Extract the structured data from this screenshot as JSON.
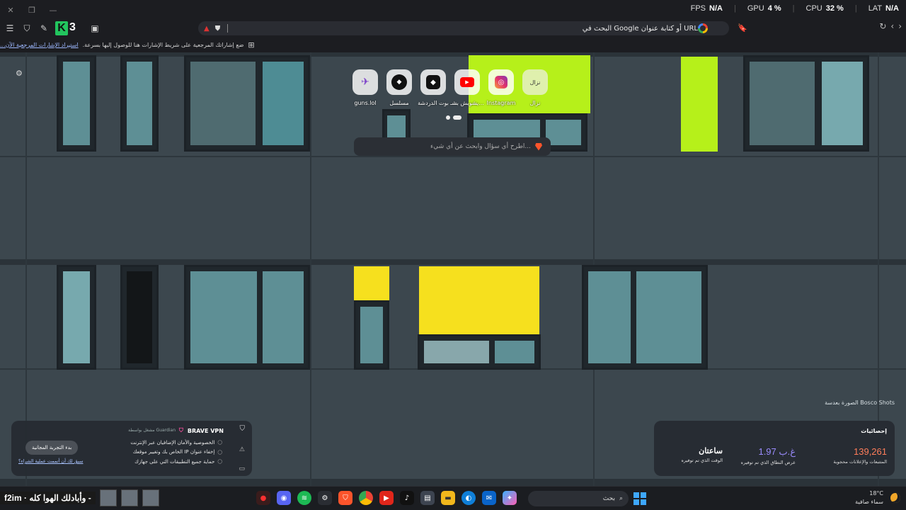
{
  "perf": {
    "fps_label": "FPS",
    "fps_value": "N/A",
    "gpu_label": "GPU",
    "gpu_value": "4 %",
    "cpu_label": "CPU",
    "cpu_value": "32 %",
    "lat_label": "LAT",
    "lat_value": "N/A"
  },
  "urlbar": {
    "placeholder": "البحث في Google أو كتابة عنوان URL"
  },
  "bookmarks_bar": {
    "message": "ضع إشاراتك المرجعية على شريط الإشارات هنا للوصول إليها بسرعة.",
    "import_link": "استيراد الإشارات المرجعية الآن..."
  },
  "top_sites": [
    {
      "label": "نزال",
      "icon": "nzal-icon",
      "glyph": "نزال"
    },
    {
      "label": "Instagram",
      "icon": "instagram-icon",
      "glyph": "◎"
    },
    {
      "label": "يشويش بشـ...",
      "icon": "youtube-icon",
      "glyph": "▶"
    },
    {
      "label": "بوت الدردشة",
      "icon": "chatbot-icon",
      "glyph": "◆"
    },
    {
      "label": "مسلسل",
      "icon": "series-icon",
      "glyph": "◆"
    },
    {
      "label": "guns.lol",
      "icon": "gun-icon",
      "glyph": "✈"
    }
  ],
  "search": {
    "placeholder": "اطرح أي سؤال وابحث عن أي شيء..."
  },
  "vpn": {
    "title": "BRAVE VPN",
    "powered_by": "مشغل بواسطة Guardian",
    "features": [
      "الخصوصية والأمان الإضافيان عبر الإنترنت",
      "إخفاء عنوان IP الخاص بك وتغيير موقعك",
      "حماية جميع التطبيقات التي على جهازك"
    ],
    "trial_button": "بدء التجربة المجانية",
    "already_link": "سبق لك أن أتممت عملية الشراء؟"
  },
  "stats": {
    "title": "إحصائيات",
    "items": [
      {
        "value": "139,261",
        "caption": "المتتبعات والإعلانات محجوبة",
        "color": "#ff7d5a"
      },
      {
        "value": "1.97 غ.ب",
        "caption": "عرض النطاق الذي تم توفيره",
        "color": "#9b8cff"
      },
      {
        "value": "ساعتان",
        "caption": "الوقت الذي تم توفيره",
        "color": "#ffffff"
      }
    ]
  },
  "photo_credit": "الصورة بعدسة Bosco Shots",
  "taskbar": {
    "media_text": "f2im",
    "ticker_text": "وأبادلك الهوا كله -",
    "search_placeholder": "بحث",
    "weather_temp": "18°C",
    "weather_desc": "سماء صافية"
  }
}
